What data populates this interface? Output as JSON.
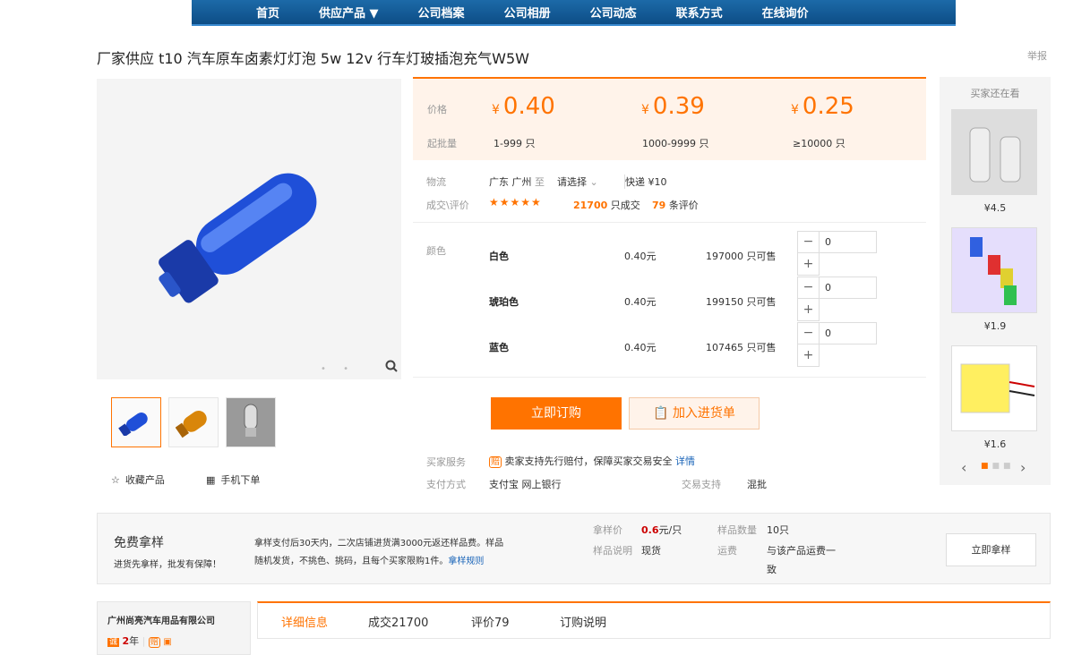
{
  "nav": [
    "首页",
    "供应产品 ▼",
    "公司档案",
    "公司相册",
    "公司动态",
    "联系方式",
    "在线询价"
  ],
  "title": "厂家供应 t10 汽车原车卤素灯灯泡 5w 12v 行车灯玻插泡充气W5W",
  "report": "举报",
  "gallery": {
    "dots": "• •",
    "zoom_icon": "search-icon"
  },
  "actions": {
    "favorite": "收藏产品",
    "mobile": "手机下单"
  },
  "price": {
    "price_label": "价格",
    "moq_label": "起批量",
    "currency": "¥",
    "tiers": [
      {
        "price": "0.40",
        "range": "1-999 只"
      },
      {
        "price": "0.39",
        "range": "1000-9999 只"
      },
      {
        "price": "0.25",
        "range": "≥10000 只"
      }
    ]
  },
  "logistics": {
    "label": "物流",
    "from": "广东 广州",
    "to": "至",
    "select": "请选择",
    "express": "快递 ¥10"
  },
  "deal": {
    "label": "成交\\评价",
    "stars": "★★★★★",
    "deals": "21700",
    "deals_suffix": "只成交",
    "reviews": "79",
    "reviews_suffix": "条评价"
  },
  "color_label": "颜色",
  "colors": [
    {
      "name": "白色",
      "price": "0.40元",
      "stock": "197000 只可售",
      "qty": "0"
    },
    {
      "name": "琥珀色",
      "price": "0.40元",
      "stock": "199150 只可售",
      "qty": "0"
    },
    {
      "name": "蓝色",
      "price": "0.40元",
      "stock": "107465 只可售",
      "qty": "0"
    }
  ],
  "buttons": {
    "buy": "立即订购",
    "cart": "加入进货单"
  },
  "service": {
    "label": "买家服务",
    "badge": "赔",
    "text": "卖家支持先行赔付，保障买家交易安全",
    "link": "详情"
  },
  "payment": {
    "label": "支付方式",
    "methods": "支付宝  网上银行",
    "trade_label": "交易支持",
    "trade_value": "混批"
  },
  "side": {
    "header": "买家还在看",
    "items": [
      {
        "price": "¥4.5"
      },
      {
        "price": "¥1.9"
      },
      {
        "price": "¥1.6"
      }
    ]
  },
  "sample": {
    "title": "免费拿样",
    "subtitle": "进货先拿样，批发有保障！",
    "desc1": "拿样支付后30天内，二次店铺进货满3000元返还样品费。样品",
    "desc2": "随机发货，不挑色、挑码，且每个买家限购1件。",
    "rule_link": "拿样规则",
    "price_label": "拿样价",
    "price_value": "0.6",
    "price_unit": "元/只",
    "qty_label": "样品数量",
    "qty_value": "10只",
    "note_label": "样品说明",
    "note_value": "现货",
    "fee_label": "运费",
    "fee_value1": "与该产品运费一",
    "fee_value2": "致",
    "button": "立即拿样"
  },
  "company": {
    "name": "广州尚亮汽车用品有限公司",
    "years": "2",
    "years_unit": "年"
  },
  "tabs": [
    "详细信息",
    "成交21700",
    "评价79",
    "订购说明"
  ]
}
